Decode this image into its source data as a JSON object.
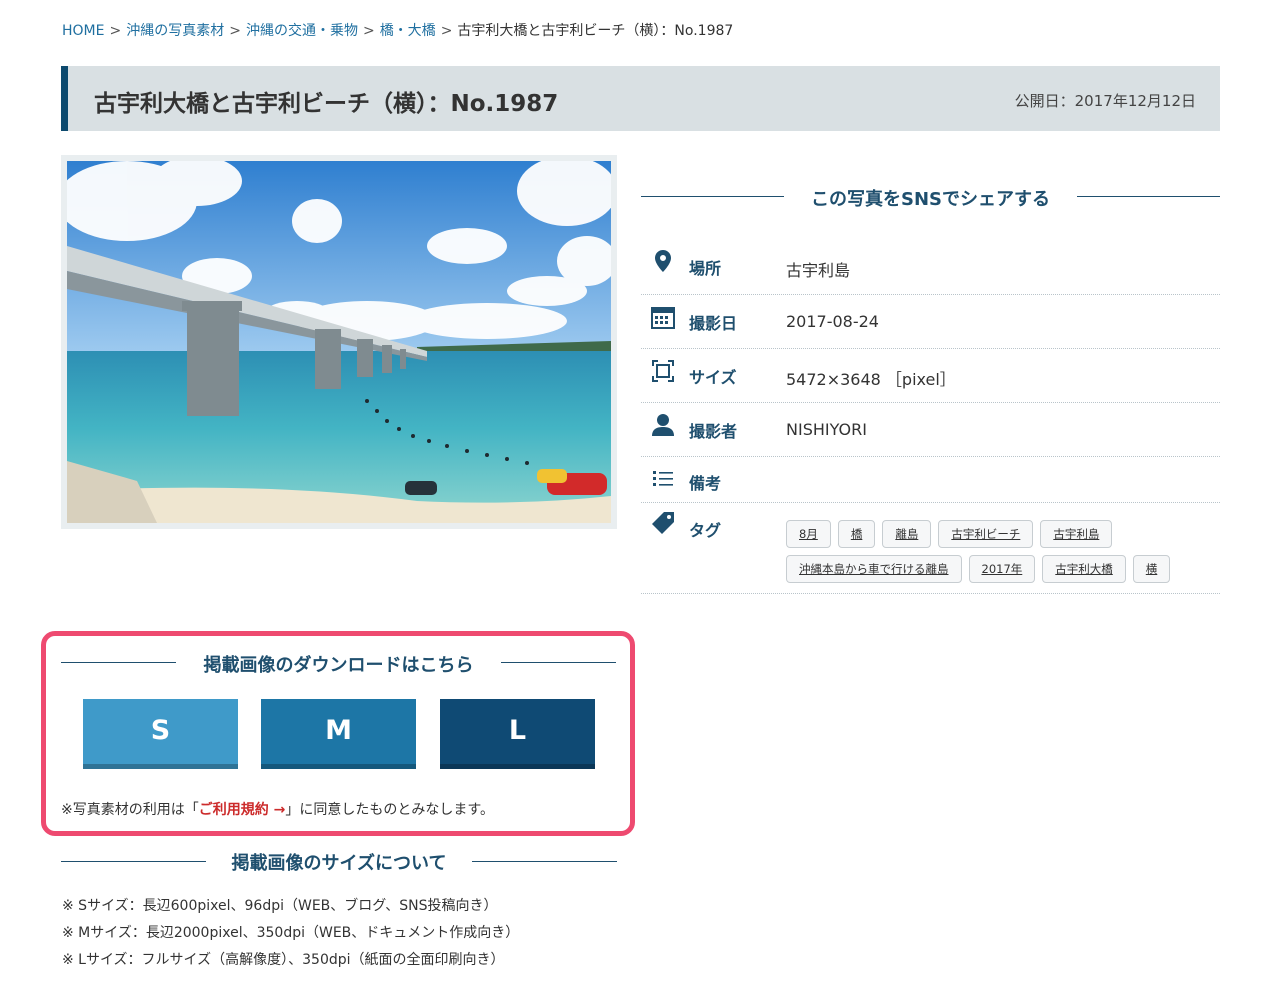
{
  "breadcrumb": {
    "home": "HOME",
    "item1": "沖縄の写真素材",
    "item2": "沖縄の交通・乗物",
    "item3": "橋・大橋",
    "current": "古宇利大橋と古宇利ビーチ（横）：No.1987",
    "separator": ">"
  },
  "header": {
    "title": "古宇利大橋と古宇利ビーチ（横）：No.1987",
    "published": "公開日：2017年12月12日"
  },
  "share": {
    "heading": "この写真をSNSでシェアする"
  },
  "info": {
    "location_label": "場所",
    "location_value": "古宇利島",
    "date_label": "撮影日",
    "date_value": "2017-08-24",
    "size_label": "サイズ",
    "size_value": "5472×3648 ［pixel］",
    "photographer_label": "撮影者",
    "photographer_value": "NISHIYORI",
    "notes_label": "備考",
    "notes_value": "",
    "tags_label": "タグ"
  },
  "tags": [
    "8月",
    "橋",
    "離島",
    "古宇利ビーチ",
    "古宇利島",
    "沖縄本島から車で行ける離島",
    "2017年",
    "古宇利大橋",
    "横"
  ],
  "download": {
    "heading": "掲載画像のダウンロードはこちら",
    "s_label": "S",
    "m_label": "M",
    "l_label": "L",
    "note_before": "※写真素材の利用は「",
    "note_link": "ご利用規約 →",
    "note_after": "」に同意したものとみなします。"
  },
  "size_info": {
    "heading": "掲載画像のサイズについて",
    "line_s": "※ Sサイズ：長辺600pixel、96dpi（WEB、ブログ、SNS投稿向き）",
    "line_m": "※ Mサイズ：長辺2000pixel、350dpi（WEB、ドキュメント作成向き）",
    "line_l": "※ Lサイズ：フルサイズ（高解像度）、350dpi（紙面の全面印刷向き）"
  },
  "colors": {
    "accent": "#1f4f6e",
    "highlight_border": "#ee4a70",
    "btn_s": "#3f9ac9",
    "btn_m": "#1d76a6",
    "btn_l": "#0f4a74",
    "link": "#1f6fa0"
  },
  "icons": [
    "map-pin-icon",
    "calendar-icon",
    "frame-size-icon",
    "user-icon",
    "list-icon",
    "tag-icon",
    "arrow-right-icon"
  ]
}
